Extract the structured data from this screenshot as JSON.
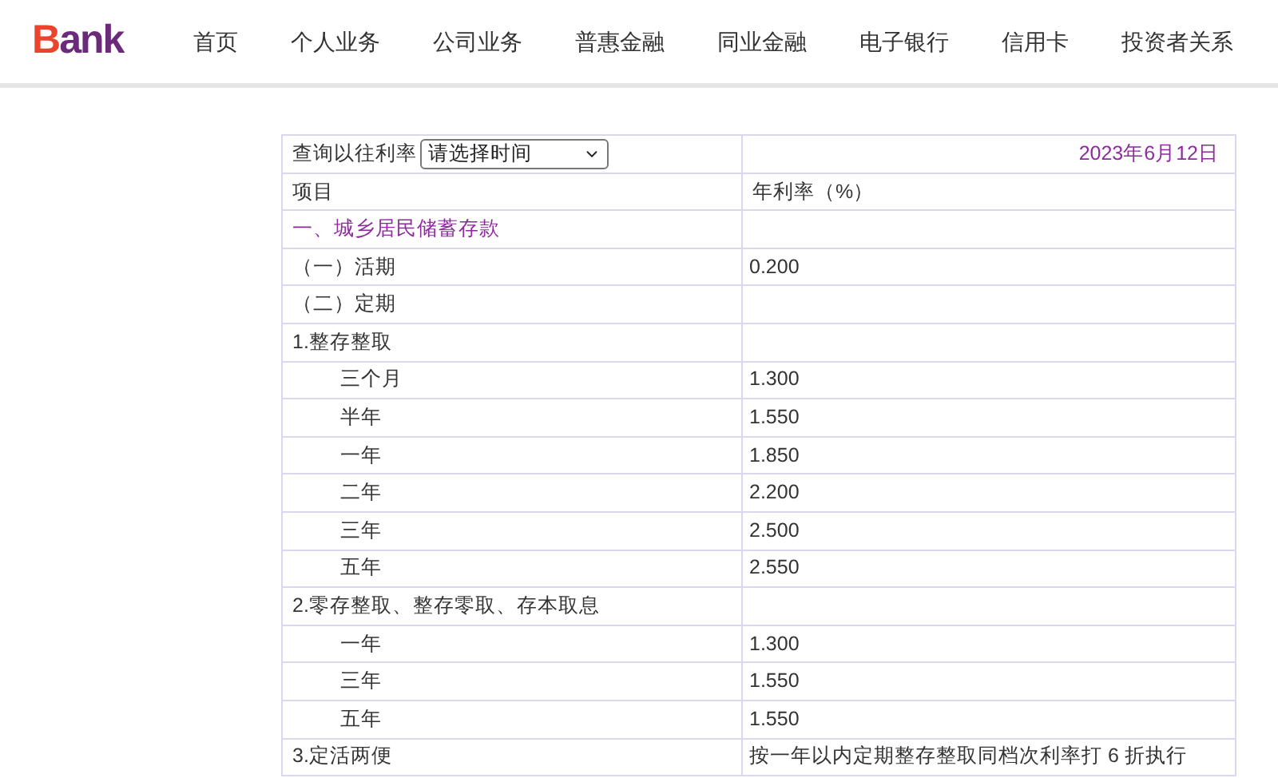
{
  "logo": {
    "text": "Bank"
  },
  "nav": [
    {
      "label": "首页"
    },
    {
      "label": "个人业务"
    },
    {
      "label": "公司业务"
    },
    {
      "label": "普惠金融"
    },
    {
      "label": "同业金融"
    },
    {
      "label": "电子银行"
    },
    {
      "label": "信用卡"
    },
    {
      "label": "投资者关系"
    }
  ],
  "query": {
    "label": "查询以往利率",
    "select": "请选择时间",
    "date": "2023年6月12日"
  },
  "table": {
    "columns": [
      "项目",
      "年利率（%）"
    ],
    "rows": [
      {
        "kind": "section",
        "item": "一、城乡居民储蓄存款",
        "rate": ""
      },
      {
        "kind": "sub",
        "item": "（一）活期",
        "rate": "0.200"
      },
      {
        "kind": "sub",
        "item": "（二）定期",
        "rate": ""
      },
      {
        "kind": "group",
        "item": "1.整存整取",
        "rate": ""
      },
      {
        "kind": "term",
        "item": "三个月",
        "rate": "1.300"
      },
      {
        "kind": "term",
        "item": "半年",
        "rate": "1.550"
      },
      {
        "kind": "term",
        "item": "一年",
        "rate": "1.850"
      },
      {
        "kind": "term",
        "item": "二年",
        "rate": "2.200"
      },
      {
        "kind": "term",
        "item": "三年",
        "rate": "2.500"
      },
      {
        "kind": "term",
        "item": "五年",
        "rate": "2.550"
      },
      {
        "kind": "group",
        "item": "2.零存整取、整存零取、存本取息",
        "rate": ""
      },
      {
        "kind": "term",
        "item": "一年",
        "rate": "1.300"
      },
      {
        "kind": "term",
        "item": "三年",
        "rate": "1.550"
      },
      {
        "kind": "term",
        "item": "五年",
        "rate": "1.550"
      },
      {
        "kind": "group",
        "item": "3.定活两便",
        "rate": "按一年以内定期整存整取同档次利率打 6 折执行"
      }
    ]
  }
}
